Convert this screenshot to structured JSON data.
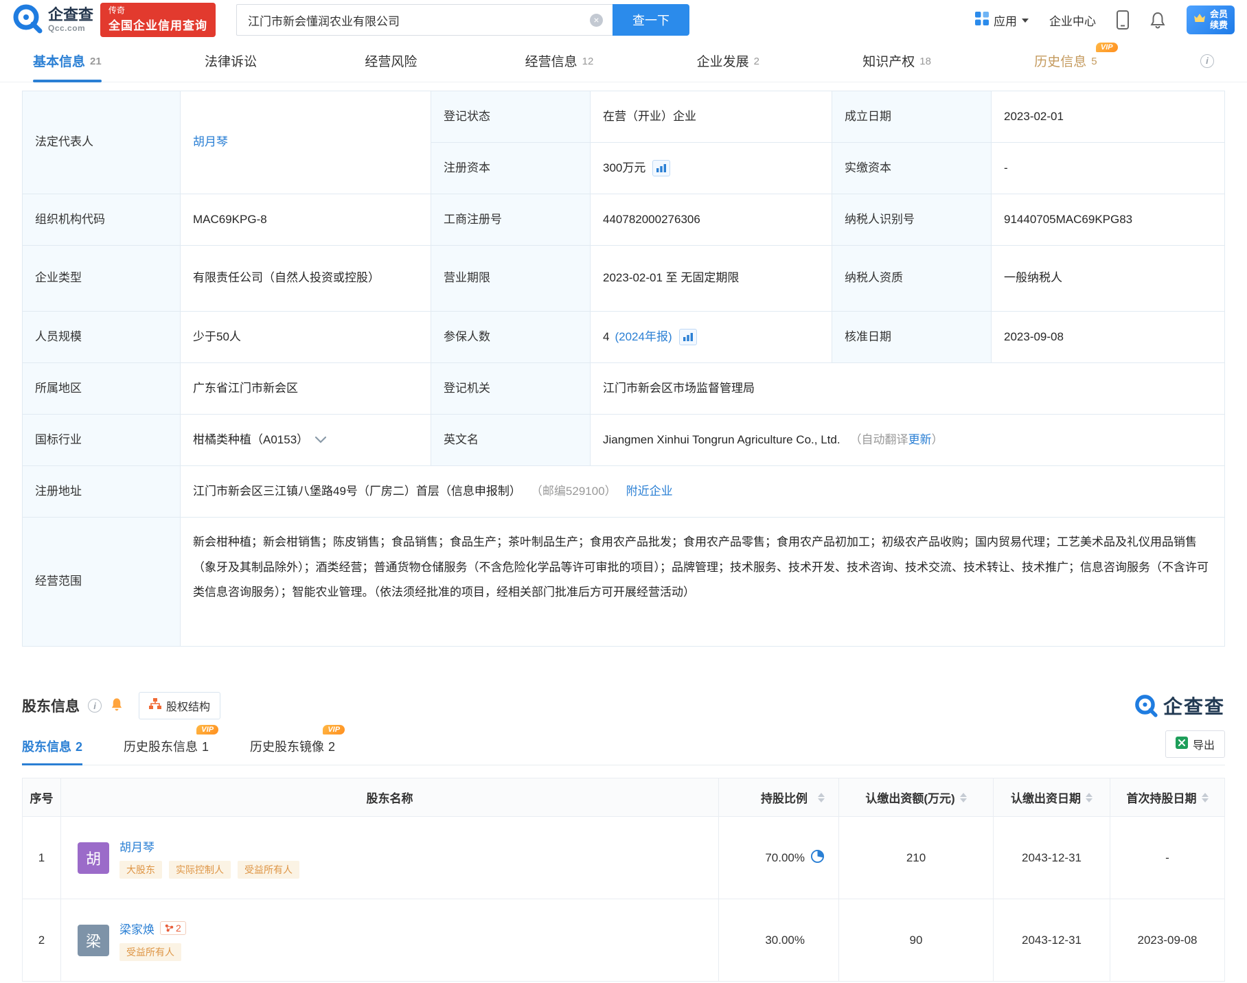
{
  "header": {
    "logo": {
      "brand": "企查查",
      "domain": "Qcc.com",
      "badge_small": "传奇",
      "badge_main": "全国企业信用查询"
    },
    "search": {
      "value": "江门市新会懂润农业有限公司",
      "button": "查一下"
    },
    "nav": {
      "apps": "应用",
      "enterprise_center": "企业中心",
      "vip_line1": "会员",
      "vip_line2": "续费"
    }
  },
  "vip": "VIP",
  "tabs": [
    {
      "label": "基本信息",
      "count": "21"
    },
    {
      "label": "法律诉讼",
      "count": ""
    },
    {
      "label": "经营风险",
      "count": ""
    },
    {
      "label": "经营信息",
      "count": "12"
    },
    {
      "label": "企业发展",
      "count": "2"
    },
    {
      "label": "知识产权",
      "count": "18"
    },
    {
      "label": "历史信息",
      "count": "5"
    }
  ],
  "basic": {
    "legal_rep": {
      "label": "法定代表人",
      "value": "胡月琴"
    },
    "reg_status": {
      "label": "登记状态",
      "value": "在营（开业）企业"
    },
    "establish_date": {
      "label": "成立日期",
      "value": "2023-02-01"
    },
    "reg_capital": {
      "label": "注册资本",
      "value": "300万元"
    },
    "paid_capital": {
      "label": "实缴资本",
      "value": "-"
    },
    "org_code": {
      "label": "组织机构代码",
      "value": "MAC69KPG-8"
    },
    "biz_reg_no": {
      "label": "工商注册号",
      "value": "440782000276306"
    },
    "taxpayer_id": {
      "label": "纳税人识别号",
      "value": "91440705MAC69KPG83"
    },
    "company_type": {
      "label": "企业类型",
      "value": "有限责任公司（自然人投资或控股）"
    },
    "biz_term": {
      "label": "营业期限",
      "value": "2023-02-01 至 无固定期限"
    },
    "taxpayer_quality": {
      "label": "纳税人资质",
      "value": "一般纳税人"
    },
    "staff_size": {
      "label": "人员规模",
      "value": "少于50人"
    },
    "insured": {
      "label": "参保人数",
      "value": "4",
      "link": "(2024年报)"
    },
    "approval_date": {
      "label": "核准日期",
      "value": "2023-09-08"
    },
    "region": {
      "label": "所属地区",
      "value": "广东省江门市新会区"
    },
    "reg_authority": {
      "label": "登记机关",
      "value": "江门市新会区市场监督管理局"
    },
    "industry": {
      "label": "国标行业",
      "value": "柑橘类种植（A0153）"
    },
    "english_name": {
      "label": "英文名",
      "value": "Jiangmen Xinhui Tongrun Agriculture Co., Ltd.",
      "note_prefix": "（自动翻译",
      "note_link": "更新",
      "note_suffix": "）"
    },
    "address": {
      "label": "注册地址",
      "value": "江门市新会区三江镇八堡路49号（厂房二）首层（信息申报制）",
      "postal": "（邮编529100）",
      "nearby_link": "附近企业"
    },
    "scope": {
      "label": "经营范围",
      "value": "新会柑种植；新会柑销售；陈皮销售；食品销售；食品生产；茶叶制品生产；食用农产品批发；食用农产品零售；食用农产品初加工；初级农产品收购；国内贸易代理；工艺美术品及礼仪用品销售（象牙及其制品除外）；酒类经营；普通货物仓储服务（不含危险化学品等许可审批的项目）；品牌管理；技术服务、技术开发、技术咨询、技术交流、技术转让、技术推广；信息咨询服务（不含许可类信息咨询服务）；智能农业管理。（依法须经批准的项目，经相关部门批准后方可开展经营活动）"
    }
  },
  "shareholders": {
    "section_title": "股东信息",
    "equity_structure_button": "股权结构",
    "brand_watermark": "企查查",
    "tabs": [
      {
        "label": "股东信息",
        "count": "2"
      },
      {
        "label": "历史股东信息",
        "count": "1"
      },
      {
        "label": "历史股东镜像",
        "count": "2"
      }
    ],
    "export_button": "导出",
    "columns": [
      "序号",
      "股东名称",
      "持股比例",
      "认缴出资额(万元)",
      "认缴出资日期",
      "首次持股日期"
    ],
    "rows": [
      {
        "no": "1",
        "avatar": "胡",
        "avatar_color": "#9B6BC9",
        "name": "胡月琴",
        "tags": [
          "大股东",
          "实际控制人",
          "受益所有人"
        ],
        "ratio": "70.00%",
        "amount": "210",
        "subscribe_date": "2043-12-31",
        "first_date": "-"
      },
      {
        "no": "2",
        "avatar": "梁",
        "avatar_color": "#7E93A8",
        "name": "梁家焕",
        "relation_count": "2",
        "tags": [
          "受益所有人"
        ],
        "ratio": "30.00%",
        "amount": "90",
        "subscribe_date": "2043-12-31",
        "first_date": "2023-09-08"
      }
    ]
  },
  "colors": {
    "primary_blue": "#2B8BEB",
    "link_blue": "#2A7FD4",
    "brand_red": "#E23A2E",
    "tag_orange": "#DE9545",
    "vip_orange": "#FF8F1F",
    "gold_tab": "#C49A5E"
  }
}
